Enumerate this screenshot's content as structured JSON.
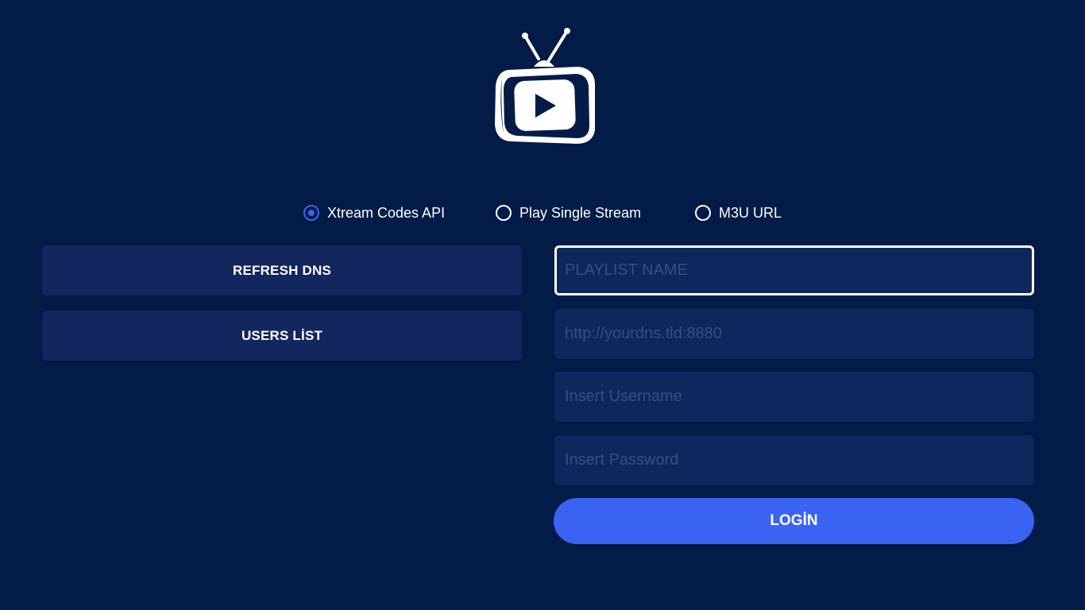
{
  "logo": {
    "icon": "tv-play-logo-icon"
  },
  "login_type": {
    "options": [
      {
        "label": "Xtream Codes API",
        "selected": true
      },
      {
        "label": "Play Single Stream",
        "selected": false
      },
      {
        "label": "M3U URL",
        "selected": false
      }
    ]
  },
  "sidebar": {
    "refresh_dns_label": "REFRESH DNS",
    "users_list_label": "USERS LİST"
  },
  "form": {
    "playlist_name": {
      "value": "",
      "placeholder": "PLAYLIST NAME"
    },
    "dns_url": {
      "value": "",
      "placeholder": "http://yourdns.tld:8880"
    },
    "username": {
      "value": "",
      "placeholder": "Insert Username"
    },
    "password": {
      "value": "",
      "placeholder": "Insert Password"
    },
    "login_label": "LOGİN"
  },
  "colors": {
    "background": "#021b47",
    "panel": "#13265d",
    "field": "#0f275c",
    "accent": "#3a63f2",
    "placeholder": "#35507f"
  }
}
